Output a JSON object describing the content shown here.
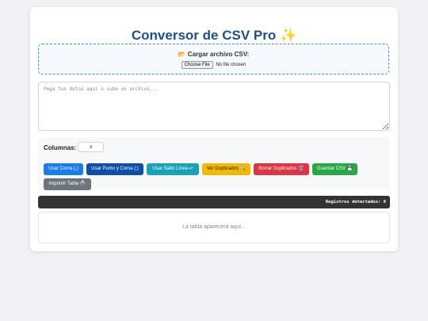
{
  "header": {
    "title": "Conversor de CSV Pro ✨"
  },
  "upload": {
    "label": "📂 Cargar archivo CSV:",
    "choose_button": "Choose File",
    "no_file_text": "No file chosen"
  },
  "editor": {
    "placeholder": "Pega tus datos aquí o sube un archivo..."
  },
  "controls": {
    "columns_label": "Columnas:",
    "columns_value": "3",
    "buttons": [
      {
        "label": "Usar Coma (,)",
        "color": "#1a7bef"
      },
      {
        "label": "Usar Punto y Coma (;)",
        "color": "#0d4fa8"
      },
      {
        "label": "Usar Salto Línea ↵",
        "color": "#17a2b8"
      },
      {
        "label": "Ver Duplicados 🔍",
        "color": "#f5b800"
      },
      {
        "label": "Borrar Duplicados 🗑️",
        "color": "#dc3545"
      },
      {
        "label": "Guardar CSV 💾",
        "color": "#28a745"
      },
      {
        "label": "Imprimir Tabla 🖨️",
        "color": "#6c757d"
      }
    ]
  },
  "status": {
    "records_text": "Registros detectados: 0"
  },
  "table": {
    "placeholder": "La tabla aparecerá aquí..."
  }
}
